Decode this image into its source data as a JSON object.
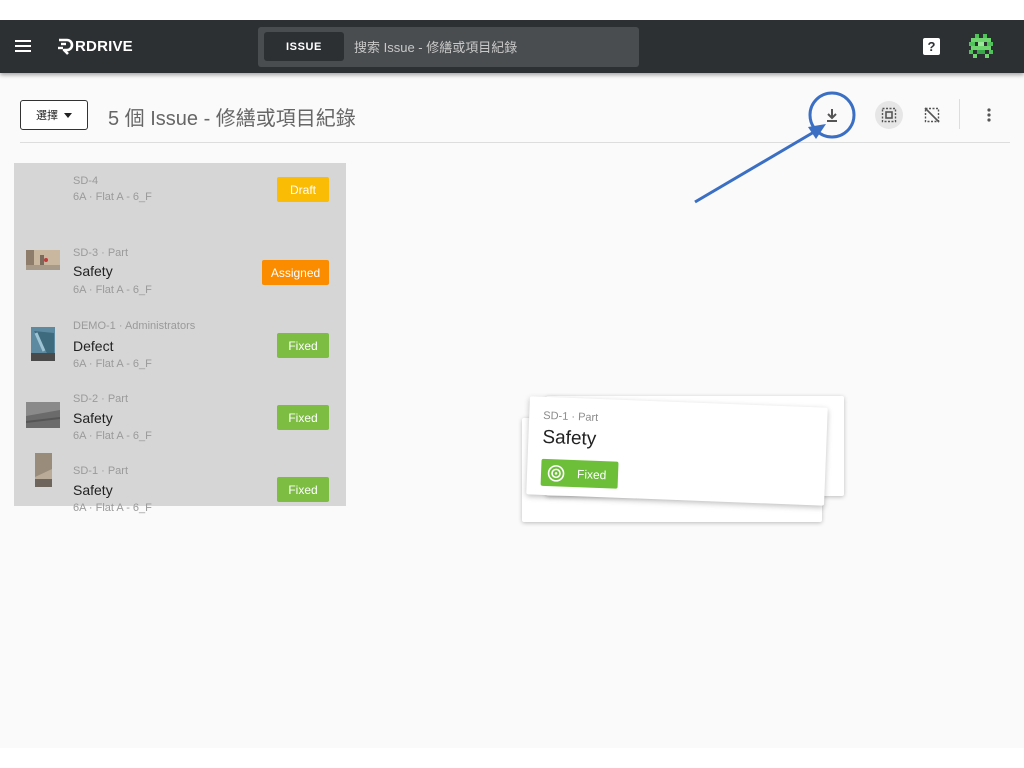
{
  "header": {
    "app_name": "RDRIVE",
    "search": {
      "chip_label": "ISSUE",
      "placeholder": "搜索 Issue - 修繕或項目紀錄"
    },
    "help_label": "?"
  },
  "toolbar": {
    "select_label": "選擇",
    "title": "5 個 Issue - 修繕或項目紀錄"
  },
  "issues": [
    {
      "meta": "SD-4",
      "type": "",
      "location": "6A · Flat A - 6_F",
      "status": "Draft",
      "status_color": "#fbbc05"
    },
    {
      "meta": "SD-3 · Part",
      "type": "Safety",
      "location": "6A · Flat A - 6_F",
      "status": "Assigned",
      "status_color": "#fb8c00"
    },
    {
      "meta": "DEMO-1 · Administrators",
      "type": "Defect",
      "location": "6A · Flat A - 6_F",
      "status": "Fixed",
      "status_color": "#7cbd42"
    },
    {
      "meta": "SD-2 · Part",
      "type": "Safety",
      "location": "6A · Flat A - 6_F",
      "status": "Fixed",
      "status_color": "#7cbd42"
    },
    {
      "meta": "SD-1 · Part",
      "type": "Safety",
      "location": "6A · Flat A - 6_F",
      "status": "Fixed",
      "status_color": "#7cbd42"
    }
  ],
  "preview_card": {
    "meta": "SD-1 · Part",
    "type": "Safety",
    "status": "Fixed",
    "status_color": "#6dbf3a"
  },
  "colors": {
    "topbar": "#2d3033",
    "annotation": "#3a6fc4",
    "list_bg": "#d6d6d6"
  }
}
